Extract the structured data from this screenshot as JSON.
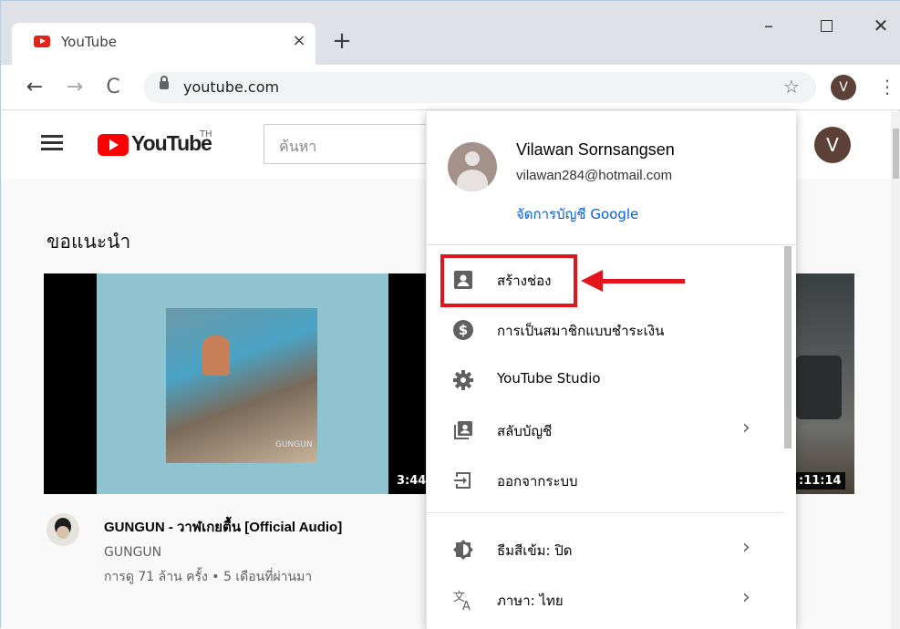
{
  "browser": {
    "tab_title": "YouTube",
    "tab_close": "×",
    "new_tab": "+",
    "url": "youtube.com",
    "profile_initial": "V",
    "minimize": "–",
    "close": "✕",
    "back": "←",
    "forward": "→",
    "reload": "C",
    "bookmark": "☆",
    "menu": "⋮"
  },
  "youtube": {
    "logo_text": "YouTube",
    "country": "TH",
    "search_placeholder": "ค้นหา",
    "avatar_initial": "V",
    "section_title": "ขอแนะนำ",
    "videos": [
      {
        "title": "GUNGUN - วาฬเกยตื้น [Official Audio]",
        "channel": "GUNGUN",
        "meta": "การดู 71 ล้าน ครั้ง • 5 เดือนที่ผ่านมา",
        "duration": "3:44",
        "thumb_text": "GUNGUN"
      },
      {
        "duration": ":11:14"
      }
    ]
  },
  "account_menu": {
    "name": "Vilawan Sornsangsen",
    "email": "vilawan284@hotmail.com",
    "manage_link": "จัดการบัญชี Google",
    "items": [
      {
        "label": "สร้างช่อง",
        "icon": "person-card-icon"
      },
      {
        "label": "การเป็นสมาชิกแบบชำระเงิน",
        "icon": "dollar-circle-icon"
      },
      {
        "label": "YouTube Studio",
        "icon": "gear-icon"
      },
      {
        "label": "สลับบัญชี",
        "icon": "switch-account-icon",
        "chevron": "›"
      },
      {
        "label": "ออกจากระบบ",
        "icon": "sign-out-icon"
      },
      {
        "label": "ธีมสีเข้ม: ปิด",
        "icon": "dark-theme-icon",
        "chevron": "›"
      },
      {
        "label": "ภาษา: ไทย",
        "icon": "translate-icon",
        "chevron": "›"
      }
    ]
  },
  "colors": {
    "highlight": "#e3141b",
    "link": "#065fd4",
    "brand_red": "#ff0000",
    "avatar_brown": "#5d4037"
  }
}
